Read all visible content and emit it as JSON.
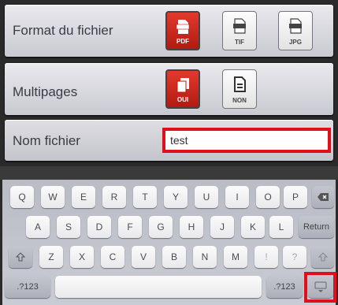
{
  "format_row": {
    "label": "Format du fichier",
    "options": [
      {
        "label": "PDF",
        "icon": "pdf-file-icon",
        "selected": true
      },
      {
        "label": "TIF",
        "icon": "tif-file-icon",
        "selected": false
      },
      {
        "label": "JPG",
        "icon": "jpg-file-icon",
        "selected": false
      }
    ]
  },
  "multipages_row": {
    "label": "Multipages",
    "options": [
      {
        "label": "OUI",
        "icon": "multi-page-icon",
        "selected": true
      },
      {
        "label": "NON",
        "icon": "single-page-icon",
        "selected": false
      }
    ]
  },
  "filename_row": {
    "label": "Nom fichier",
    "value": "test"
  },
  "keyboard": {
    "row1": [
      "Q",
      "W",
      "E",
      "R",
      "T",
      "Y",
      "U",
      "I",
      "O",
      "P"
    ],
    "row2": [
      "A",
      "S",
      "D",
      "F",
      "G",
      "H",
      "J",
      "K",
      "L"
    ],
    "row3": [
      "Z",
      "X",
      "C",
      "V",
      "B",
      "N",
      "M",
      "!",
      "?"
    ],
    "return_label": "Return",
    "numbers_label": ".?123",
    "backspace_icon": "backspace-icon",
    "shift_icon": "shift-icon",
    "hide_keyboard_icon": "hide-keyboard-icon"
  },
  "colors": {
    "selected_red": "#c8231a",
    "highlight_red": "#e0101a"
  }
}
